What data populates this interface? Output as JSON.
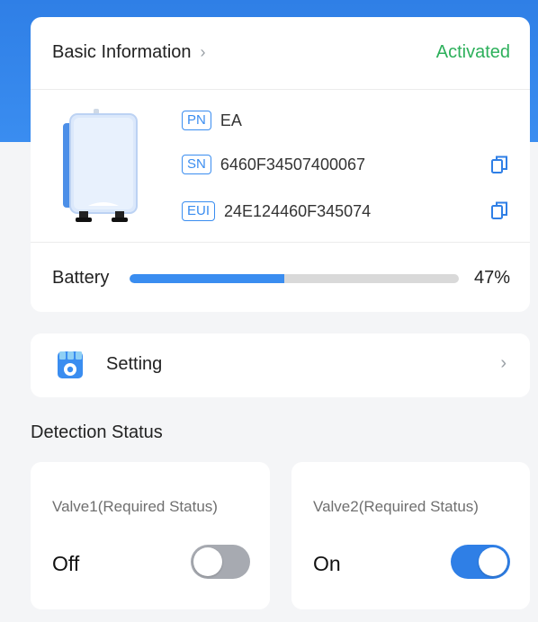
{
  "device_info": {
    "title": "Basic Information",
    "status": "Activated",
    "fields": [
      {
        "tag": "PN",
        "value": "EA",
        "copyable": false
      },
      {
        "tag": "SN",
        "value": "6460F34507400067",
        "copyable": true
      },
      {
        "tag": "EUI",
        "value": "24E124460F345074",
        "copyable": true
      }
    ]
  },
  "battery": {
    "label": "Battery",
    "percent_text": "47%",
    "percent": 47
  },
  "setting": {
    "label": "Setting",
    "icon": "gear-icon"
  },
  "detection": {
    "title": "Detection Status",
    "valves": [
      {
        "title": "Valve1(Required Status)",
        "state": "Off",
        "on": false
      },
      {
        "title": "Valve2(Required Status)",
        "state": "On",
        "on": true
      }
    ]
  },
  "colors": {
    "accent": "#2f7fe6",
    "activated": "#2db05b",
    "toggle_off": "#a7aab1"
  }
}
